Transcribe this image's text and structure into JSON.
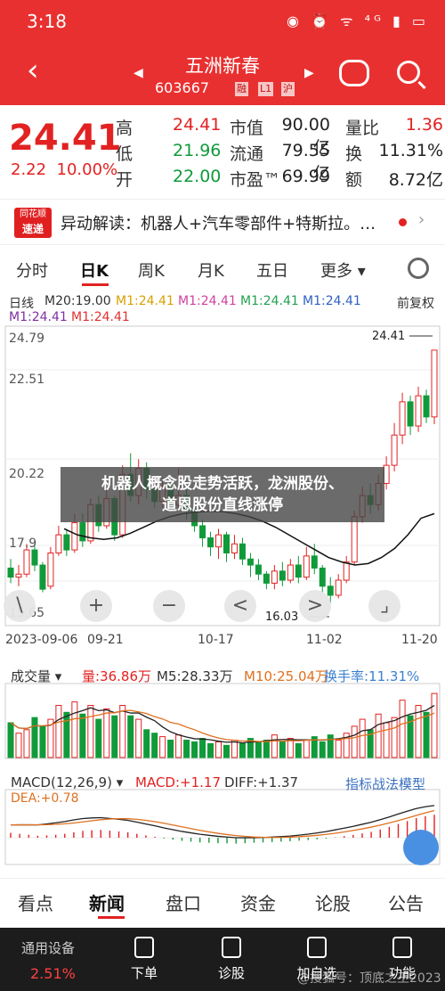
{
  "status": {
    "time": "3:18",
    "icons": "◉ ⏰ ᯤ ⁴ᴳ ▮ ▭"
  },
  "header": {
    "title": "五洲新春",
    "code": "603667",
    "tags": [
      "融",
      "L1",
      "沪"
    ]
  },
  "quote": {
    "price": "24.41",
    "change": "2.22",
    "change_pct": "10.00%",
    "rows": [
      [
        {
          "l": "高",
          "v": "24.41",
          "c": "red"
        },
        {
          "l": "市值",
          "v": "90.00亿",
          "c": "dark"
        },
        {
          "l": "量比",
          "v": "1.36",
          "c": "red"
        }
      ],
      [
        {
          "l": "低",
          "v": "21.96",
          "c": "green"
        },
        {
          "l": "流通",
          "v": "79.55亿",
          "c": "dark"
        },
        {
          "l": "换",
          "v": "11.31%",
          "c": "dark"
        }
      ],
      [
        {
          "l": "开",
          "v": "22.00",
          "c": "green"
        },
        {
          "l": "市盈™",
          "v": "69.99",
          "c": "dark"
        },
        {
          "l": "额",
          "v": "8.72亿",
          "c": "dark"
        }
      ]
    ]
  },
  "news": {
    "badge_top": "同花顺",
    "badge_bottom": "速递",
    "text": "异动解读：机器人+汽车零部件+特斯拉。…"
  },
  "period_tabs": [
    "分时",
    "日K",
    "周K",
    "月K",
    "五日",
    "更多"
  ],
  "kline_legend": {
    "row1": [
      {
        "t": "日线",
        "c": "#333"
      },
      {
        "t": "M20:19.00",
        "c": "#333"
      },
      {
        "t": "M1:24.41",
        "c": "#d8a000"
      },
      {
        "t": "M1:24.41",
        "c": "#d040a0"
      },
      {
        "t": "M1:24.41",
        "c": "#22a050"
      },
      {
        "t": "M1:24.41",
        "c": "#3060c0"
      }
    ],
    "row2": [
      {
        "t": "M1:24.41",
        "c": "#8030a0"
      },
      {
        "t": "M1:24.41",
        "c": "#e03030"
      }
    ],
    "adjust": "前复权"
  },
  "y_labels": [
    "24.79",
    "22.51",
    "20.22",
    "17.9",
    "15.65"
  ],
  "annotations": {
    "high": "24.41",
    "low": "16.03"
  },
  "x_dates": [
    "2023-09-06",
    "09-21",
    "10-17",
    "11-02",
    "11-20"
  ],
  "overlay": {
    "line1": "机器人概念股走势活跃，龙洲股份、",
    "line2": "道恩股份直线涨停"
  },
  "zoom_controls": [
    "\\",
    "+",
    "−",
    "<",
    ">",
    "⌟"
  ],
  "volume_legend": [
    {
      "t": "成交量 ▾",
      "c": "#333"
    },
    {
      "t": "量:36.86万",
      "c": "#e22222"
    },
    {
      "t": "M5:28.33万",
      "c": "#333"
    },
    {
      "t": "M10:25.04万",
      "c": "#e07020"
    },
    {
      "t": "换手率:11.31%",
      "c": "#3a80d0"
    }
  ],
  "macd_legend": [
    {
      "t": "MACD(12,26,9) ▾",
      "c": "#333"
    },
    {
      "t": "MACD:+1.17",
      "c": "#e22222"
    },
    {
      "t": "DIFF:+1.37",
      "c": "#333"
    }
  ],
  "macd_dea": "DEA:+0.78",
  "macd_model": "指标战法模型",
  "bottom_tabs": [
    "看点",
    "新闻",
    "盘口",
    "资金",
    "论股",
    "公告"
  ],
  "bottom_bar": {
    "sector_name": "通用设备",
    "sector_pct": "2.51%",
    "items": [
      "下单",
      "诊股",
      "加自选",
      "功能"
    ],
    "watermark": "@搜狐号：顶底之王2023"
  },
  "colors": {
    "up": "#e22222",
    "down": "#109a3a",
    "header_bg": "#e93030"
  },
  "chart_data": {
    "type": "candlestick",
    "x_start": "2023-09-06",
    "x_end": "2023-11-20",
    "ylim": [
      15.65,
      24.79
    ],
    "candles": [
      [
        17.2,
        16.9,
        17.5,
        16.7
      ],
      [
        16.9,
        17.0,
        17.3,
        16.6
      ],
      [
        17.0,
        17.8,
        18.0,
        16.9
      ],
      [
        17.8,
        17.3,
        18.0,
        17.1
      ],
      [
        17.3,
        16.5,
        17.4,
        16.4
      ],
      [
        16.6,
        17.7,
        17.9,
        16.5
      ],
      [
        17.7,
        18.3,
        18.6,
        17.6
      ],
      [
        18.3,
        17.8,
        18.5,
        17.6
      ],
      [
        17.8,
        18.7,
        19.0,
        17.7
      ],
      [
        18.7,
        18.1,
        19.0,
        17.9
      ],
      [
        18.1,
        19.3,
        19.5,
        18.0
      ],
      [
        19.3,
        18.6,
        19.6,
        18.4
      ],
      [
        18.6,
        19.5,
        19.8,
        18.5
      ],
      [
        19.5,
        18.3,
        19.6,
        18.1
      ],
      [
        18.3,
        20.3,
        20.6,
        18.2
      ],
      [
        20.3,
        19.6,
        21.0,
        19.4
      ],
      [
        19.6,
        20.5,
        20.8,
        19.3
      ],
      [
        20.5,
        19.8,
        20.7,
        19.5
      ],
      [
        19.8,
        19.4,
        20.1,
        19.2
      ],
      [
        19.4,
        19.9,
        20.2,
        19.2
      ],
      [
        19.9,
        19.3,
        20.2,
        19.1
      ],
      [
        19.3,
        19.6,
        20.5,
        19.1
      ],
      [
        19.6,
        19.1,
        19.8,
        18.8
      ],
      [
        19.1,
        18.6,
        19.3,
        18.4
      ],
      [
        18.6,
        18.2,
        18.8,
        17.9
      ],
      [
        18.2,
        17.9,
        18.4,
        17.6
      ],
      [
        17.9,
        18.3,
        18.5,
        17.5
      ],
      [
        18.3,
        17.7,
        18.4,
        17.4
      ],
      [
        17.7,
        18.0,
        18.3,
        17.5
      ],
      [
        18.0,
        17.5,
        18.2,
        17.3
      ],
      [
        17.5,
        17.3,
        17.7,
        16.9
      ],
      [
        17.3,
        17.0,
        17.5,
        16.8
      ],
      [
        17.0,
        16.7,
        17.1,
        16.5
      ],
      [
        16.7,
        17.1,
        17.3,
        16.5
      ],
      [
        17.1,
        16.8,
        17.4,
        16.6
      ],
      [
        16.8,
        17.3,
        17.5,
        16.7
      ],
      [
        17.3,
        16.9,
        17.6,
        16.7
      ],
      [
        16.9,
        17.6,
        17.9,
        16.8
      ],
      [
        17.6,
        17.2,
        18.0,
        17.0
      ],
      [
        17.2,
        16.6,
        17.3,
        16.4
      ],
      [
        16.6,
        16.3,
        16.9,
        16.03
      ],
      [
        16.3,
        16.8,
        17.0,
        16.2
      ],
      [
        16.8,
        17.4,
        17.6,
        16.7
      ],
      [
        17.4,
        18.9,
        19.1,
        17.3
      ],
      [
        18.9,
        19.6,
        19.9,
        18.7
      ],
      [
        19.6,
        19.3,
        20.0,
        19.0
      ],
      [
        19.3,
        20.0,
        20.3,
        19.1
      ],
      [
        20.0,
        20.6,
        20.9,
        19.8
      ],
      [
        20.6,
        21.6,
        22.0,
        20.4
      ],
      [
        21.6,
        22.7,
        23.0,
        21.3
      ],
      [
        22.7,
        21.9,
        22.9,
        21.6
      ],
      [
        21.9,
        22.9,
        23.2,
        21.7
      ],
      [
        22.9,
        22.2,
        23.1,
        22.0
      ],
      [
        22.2,
        24.41,
        24.41,
        21.96
      ]
    ],
    "ma20": [
      18.5,
      18.3,
      18.2,
      18.15,
      18.2,
      18.35,
      18.55,
      18.75,
      18.9,
      19.0,
      19.05,
      19.08,
      19.07,
      19.0,
      18.9,
      18.75,
      18.55,
      18.3,
      18.05,
      17.8,
      17.55,
      17.4,
      17.3,
      17.35,
      17.55,
      17.85,
      18.3,
      18.85,
      19.0
    ],
    "volume": {
      "series": [
        {
          "name": "量",
          "values_wan": [
            20,
            14,
            16,
            23,
            18,
            22,
            30,
            26,
            32,
            25,
            30,
            22,
            28,
            24,
            30,
            24,
            22,
            16,
            14,
            12,
            10,
            13,
            10,
            9,
            11,
            8,
            9,
            7,
            10,
            8,
            11,
            9,
            10,
            13,
            9,
            11,
            8,
            10,
            12,
            9,
            13,
            10,
            14,
            18,
            22,
            16,
            25,
            20,
            23,
            33,
            24,
            30,
            26,
            36.86
          ]
        },
        {
          "name": "M5",
          "value_last_wan": 28.33
        },
        {
          "name": "M10",
          "value_last_wan": 25.04
        }
      ]
    },
    "macd": {
      "hist": [
        0.25,
        0.2,
        0.15,
        0.1,
        0.12,
        0.15,
        0.2,
        0.28,
        0.35,
        0.38,
        0.4,
        0.36,
        0.32,
        0.28,
        0.2,
        0.12,
        0.05,
        -0.04,
        -0.1,
        -0.16,
        -0.2,
        -0.24,
        -0.26,
        -0.28,
        -0.29,
        -0.3,
        -0.28,
        -0.26,
        -0.24,
        -0.22,
        -0.2,
        -0.18,
        -0.15,
        -0.12,
        -0.08,
        -0.04,
        0.02,
        0.08,
        0.14,
        0.22,
        0.3,
        0.42,
        0.55,
        0.7,
        0.85,
        1.0,
        1.1,
        1.17
      ],
      "diff_last": 1.37,
      "dea_last": 0.78,
      "macd_last": 1.17
    }
  }
}
